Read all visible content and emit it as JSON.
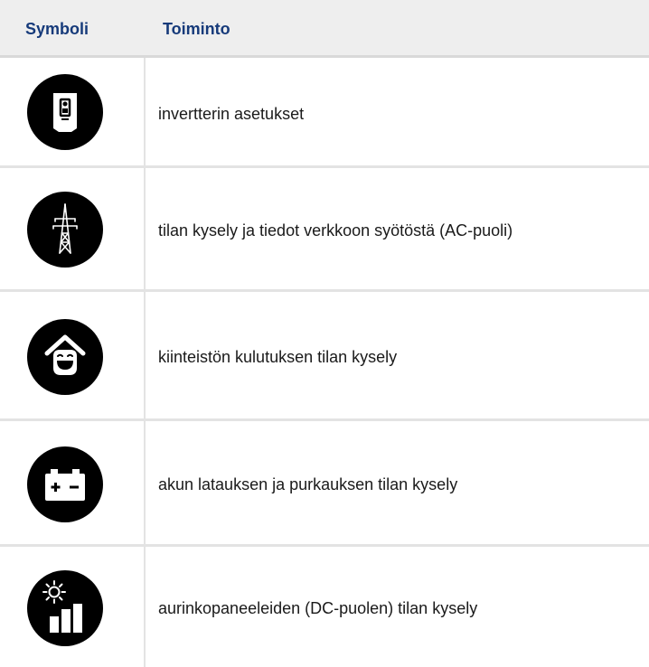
{
  "table": {
    "headers": {
      "symbol": "Symboli",
      "function": "Toiminto"
    },
    "rows": [
      {
        "icon": "inverter-icon",
        "label": "invertterin asetukset"
      },
      {
        "icon": "power-pylon-icon",
        "label": "tilan kysely ja tiedot verkkoon syötöstä (AC-puoli)"
      },
      {
        "icon": "smiling-house-icon",
        "label": "kiinteistön kulutuksen tilan kysely"
      },
      {
        "icon": "battery-icon",
        "label": "akun latauksen ja purkauksen tilan kysely"
      },
      {
        "icon": "sun-bar-chart-icon",
        "label": "aurinkopaneeleiden (DC-puolen) tilan kysely"
      }
    ]
  },
  "colors": {
    "header_text": "#163a7a",
    "header_bg": "#eeeeee",
    "icon_fill": "#000000",
    "divider": "#e3e3e3"
  }
}
